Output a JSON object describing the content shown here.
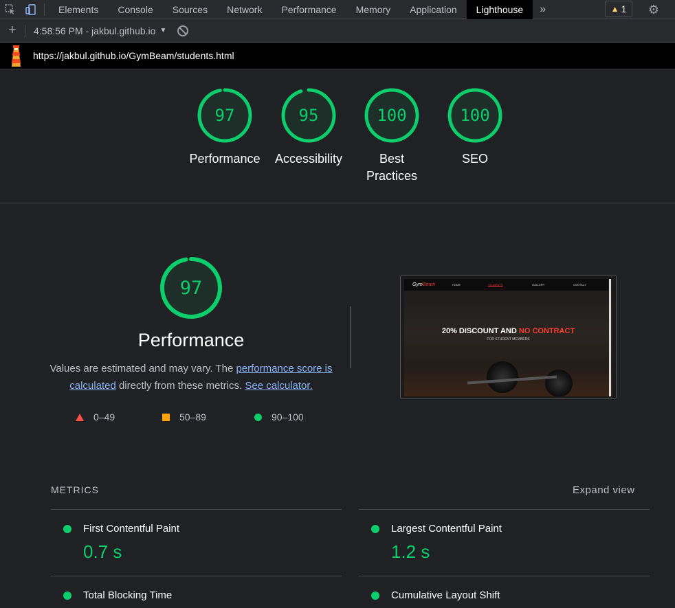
{
  "devtools": {
    "tabs": [
      "Elements",
      "Console",
      "Sources",
      "Network",
      "Performance",
      "Memory",
      "Application",
      "Lighthouse"
    ],
    "active_tab": "Lighthouse",
    "more": "»",
    "warning_count": "1"
  },
  "toolbar": {
    "report": "4:58:56 PM - jakbul.github.io",
    "add": "+"
  },
  "url": "https://jakbul.github.io/GymBeam/students.html",
  "scores": [
    {
      "label": "Performance",
      "value": "97"
    },
    {
      "label": "Accessibility",
      "value": "95"
    },
    {
      "label": "Best Practices",
      "value": "100"
    },
    {
      "label": "SEO",
      "value": "100"
    }
  ],
  "score_values": [
    97,
    95,
    100,
    100
  ],
  "performance": {
    "score": "97",
    "score_value": 97,
    "title": "Performance",
    "desc_prefix": "Values are estimated and may vary. The ",
    "desc_link1": "performance score is calculated",
    "desc_mid": " directly from these metrics. ",
    "desc_link2": "See calculator.",
    "legend": [
      "0–49",
      "50–89",
      "90–100"
    ]
  },
  "screenshot": {
    "logo_a": "Gym",
    "logo_b": "Beam",
    "nav": [
      "HOME",
      "STUDENTS",
      "GALLERY",
      "CONTACT"
    ],
    "headline_a": "20% DISCOUNT AND ",
    "headline_b": "NO CONTRACT",
    "sub": "FOR STUDENT MEMBERS"
  },
  "metrics": {
    "header": "METRICS",
    "expand": "Expand view",
    "items": [
      {
        "name": "First Contentful Paint",
        "value": "0.7 s"
      },
      {
        "name": "Largest Contentful Paint",
        "value": "1.2 s"
      },
      {
        "name": "Total Blocking Time",
        "value": ""
      },
      {
        "name": "Cumulative Layout Shift",
        "value": ""
      }
    ]
  },
  "colors": {
    "pass": "#0cce6b",
    "average": "#ffa400",
    "fail": "#ff4e42",
    "link": "#8ab4f8"
  }
}
